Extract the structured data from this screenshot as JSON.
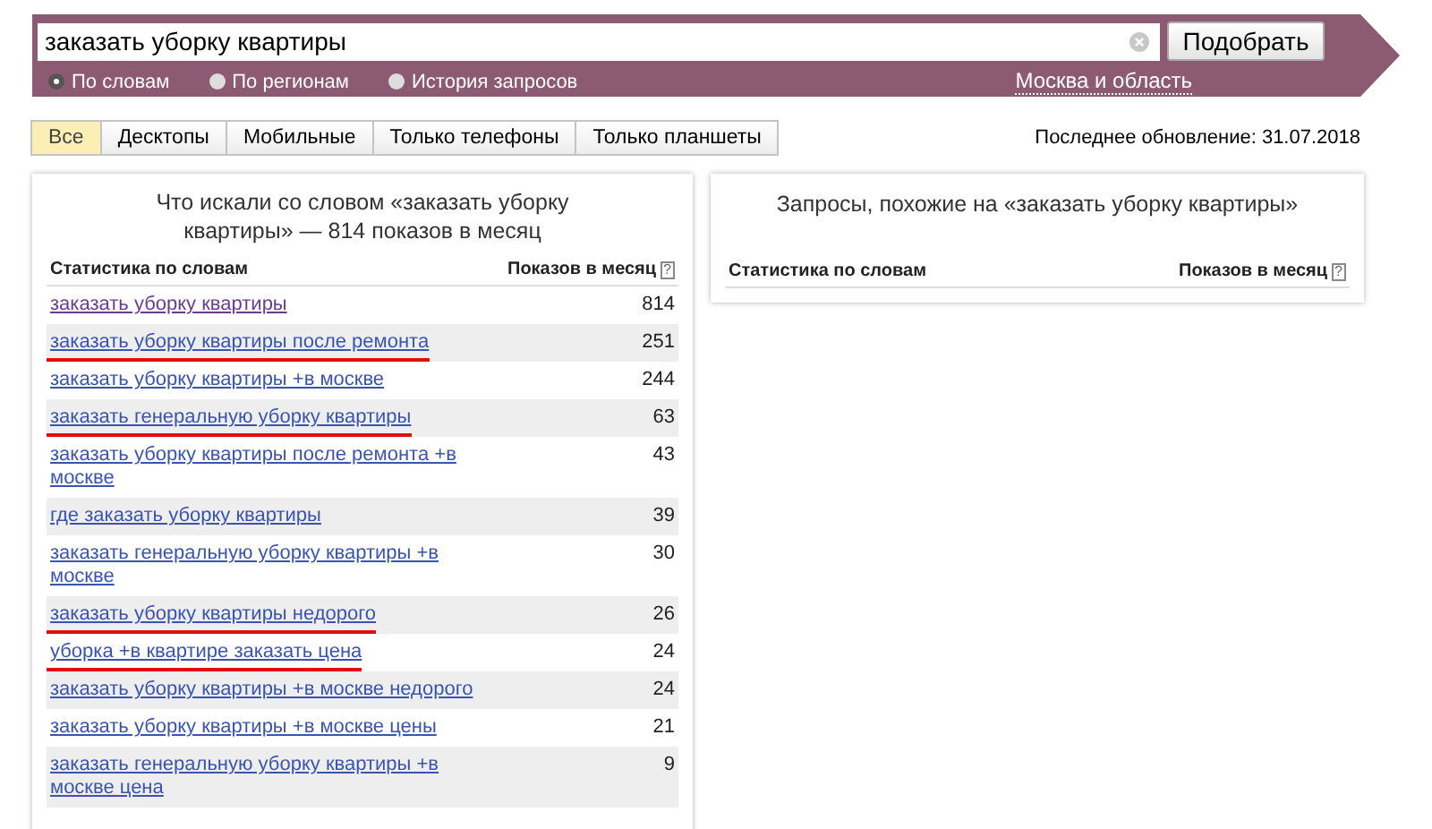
{
  "search": {
    "value": "заказать уборку квартиры",
    "button": "Подобрать"
  },
  "modes": [
    {
      "label": "По словам",
      "selected": true
    },
    {
      "label": "По регионам",
      "selected": false
    },
    {
      "label": "История запросов",
      "selected": false
    }
  ],
  "region": "Москва и область",
  "tabs": [
    {
      "label": "Все",
      "selected": true
    },
    {
      "label": "Десктопы",
      "selected": false
    },
    {
      "label": "Мобильные",
      "selected": false
    },
    {
      "label": "Только телефоны",
      "selected": false
    },
    {
      "label": "Только планшеты",
      "selected": false
    }
  ],
  "last_update": "Последнее обновление: 31.07.2018",
  "left_panel": {
    "title": "Что искали со словом «заказать уборку квартиры» — 814 показов в месяц",
    "columns": [
      "Статистика по словам",
      "Показов в месяц"
    ],
    "help": "?",
    "rows": [
      {
        "query": "заказать уборку квартиры",
        "count": "814",
        "visited": true,
        "underlined": false
      },
      {
        "query": "заказать уборку квартиры после ремонта",
        "count": "251",
        "visited": false,
        "underlined": true
      },
      {
        "query": "заказать уборку квартиры +в москве",
        "count": "244",
        "visited": false,
        "underlined": false
      },
      {
        "query": "заказать генеральную уборку квартиры",
        "count": "63",
        "visited": false,
        "underlined": true
      },
      {
        "query": "заказать уборку квартиры после ремонта +в москве",
        "count": "43",
        "visited": false,
        "underlined": false
      },
      {
        "query": "где заказать уборку квартиры",
        "count": "39",
        "visited": false,
        "underlined": false
      },
      {
        "query": "заказать генеральную уборку квартиры +в москве",
        "count": "30",
        "visited": false,
        "underlined": false
      },
      {
        "query": "заказать уборку квартиры недорого",
        "count": "26",
        "visited": false,
        "underlined": true
      },
      {
        "query": "уборка +в квартире заказать цена",
        "count": "24",
        "visited": false,
        "underlined": true
      },
      {
        "query": "заказать уборку квартиры +в москве недорого",
        "count": "24",
        "visited": false,
        "underlined": false
      },
      {
        "query": "заказать уборку квартиры +в москве цены",
        "count": "21",
        "visited": false,
        "underlined": false
      },
      {
        "query": "заказать генеральную уборку квартиры +в москве цена",
        "count": "9",
        "visited": false,
        "underlined": false
      }
    ]
  },
  "right_panel": {
    "title": "Запросы, похожие на «заказать уборку квартиры»",
    "columns": [
      "Статистика по словам",
      "Показов в месяц"
    ],
    "help": "?"
  }
}
